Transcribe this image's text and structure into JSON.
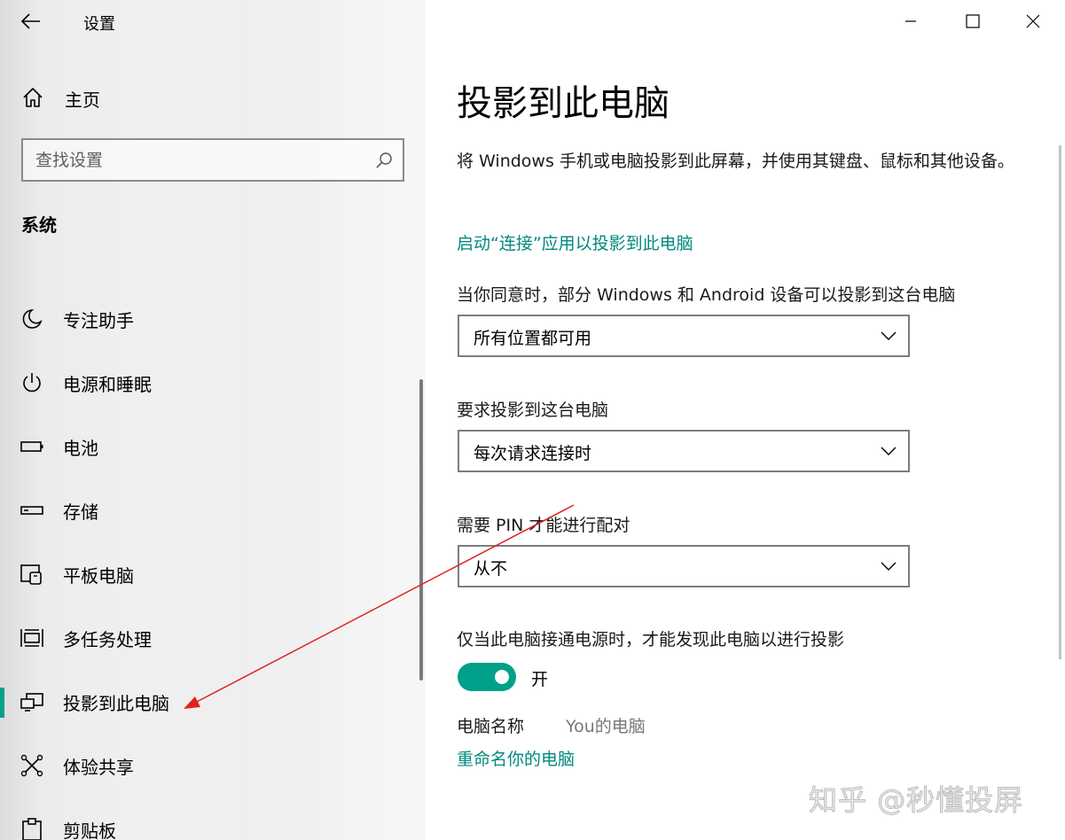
{
  "window": {
    "title": "设置"
  },
  "nav": {
    "home_label": "主页",
    "search_placeholder": "查找设置",
    "section_title": "系统",
    "items": [
      {
        "label": "专注助手",
        "icon": "moon-icon",
        "selected": false
      },
      {
        "label": "电源和睡眠",
        "icon": "power-icon",
        "selected": false
      },
      {
        "label": "电池",
        "icon": "battery-icon",
        "selected": false
      },
      {
        "label": "存储",
        "icon": "storage-icon",
        "selected": false
      },
      {
        "label": "平板电脑",
        "icon": "tablet-mode-icon",
        "selected": false
      },
      {
        "label": "多任务处理",
        "icon": "multitasking-icon",
        "selected": false
      },
      {
        "label": "投影到此电脑",
        "icon": "project-icon",
        "selected": true
      },
      {
        "label": "体验共享",
        "icon": "shared-experiences-icon",
        "selected": false
      },
      {
        "label": "剪贴板",
        "icon": "clipboard-icon",
        "selected": false
      }
    ]
  },
  "content": {
    "page_title": "投影到此电脑",
    "description": "将 Windows 手机或电脑投影到此屏幕，并使用其键盘、鼠标和其他设备。",
    "launch_link": "启动“连接”应用以投影到此电脑",
    "availability": {
      "label": "当你同意时，部分 Windows 和 Android 设备可以投影到这台电脑",
      "value": "所有位置都可用"
    },
    "ask_to_project": {
      "label": "要求投影到这台电脑",
      "value": "每次请求连接时"
    },
    "require_pin": {
      "label": "需要 PIN 才能进行配对",
      "value": "从不"
    },
    "power_only": {
      "label": "仅当此电脑接通电源时，才能发现此电脑以进行投影",
      "toggle_on": true,
      "toggle_label": "开"
    },
    "pc_name": {
      "label": "电脑名称",
      "value": "You的电脑"
    },
    "rename_link": "重命名你的电脑"
  },
  "watermark": "知乎 @秒懂投屏",
  "colors": {
    "accent": "#00a08a",
    "link": "#00897f",
    "annotation_arrow": "#e02020"
  }
}
